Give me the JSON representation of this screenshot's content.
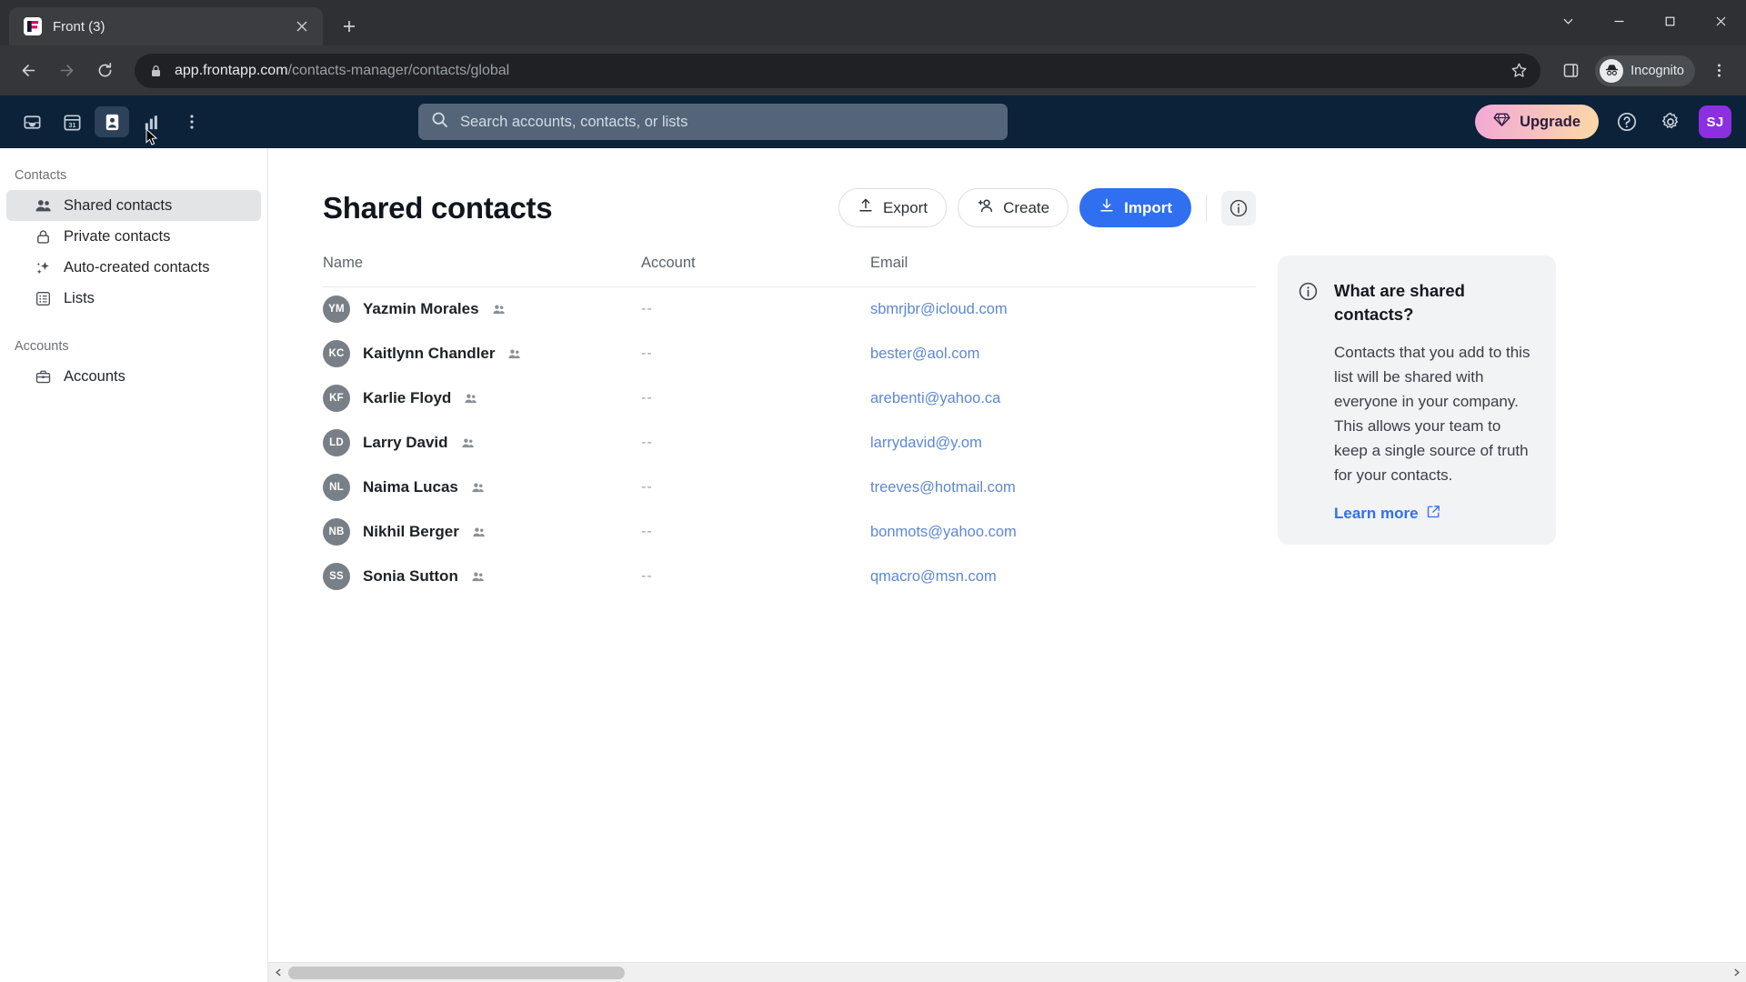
{
  "browser": {
    "tab": {
      "title": "Front (3)",
      "favicon_icon": "front-logo-icon",
      "close_icon": "close-icon"
    },
    "new_tab_icon": "plus-icon",
    "window_controls": {
      "chevron_icon": "chevron-down-icon",
      "minimize_icon": "minimize-icon",
      "maximize_icon": "maximize-icon",
      "close_icon": "close-icon"
    },
    "nav": {
      "back_icon": "back-arrow-icon",
      "forward_icon": "forward-arrow-icon",
      "reload_icon": "reload-icon"
    },
    "omnibox": {
      "lock_icon": "lock-icon",
      "url_host": "app.frontapp.com",
      "url_path": "/contacts-manager/contacts/global",
      "bookmark_icon": "star-icon"
    },
    "side_panel_icon": "side-panel-icon",
    "incognito": {
      "label": "Incognito",
      "icon": "incognito-icon"
    },
    "menu_icon": "kebab-menu-icon"
  },
  "app_header": {
    "nav_icons": [
      {
        "name": "inbox-icon",
        "label": "Inbox",
        "active": false
      },
      {
        "name": "calendar-icon",
        "label": "31",
        "active": false
      },
      {
        "name": "contacts-icon",
        "label": "Contacts",
        "active": true
      },
      {
        "name": "analytics-icon",
        "label": "Analytics",
        "active": false
      },
      {
        "name": "more-icon",
        "label": "More",
        "active": false
      }
    ],
    "search": {
      "placeholder": "Search accounts, contacts, or lists",
      "icon": "search-icon"
    },
    "upgrade": {
      "label": "Upgrade",
      "icon": "diamond-icon"
    },
    "help_icon": "help-circle-icon",
    "settings_icon": "gear-icon",
    "avatar": {
      "initials": "SJ",
      "color": "#8b2fe0"
    }
  },
  "sidebar": {
    "sections": [
      {
        "title": "Contacts",
        "items": [
          {
            "label": "Shared contacts",
            "icon": "people-icon",
            "active": true
          },
          {
            "label": "Private contacts",
            "icon": "lock-icon",
            "active": false
          },
          {
            "label": "Auto-created contacts",
            "icon": "sparkle-icon",
            "active": false
          },
          {
            "label": "Lists",
            "icon": "list-icon",
            "active": false
          }
        ]
      },
      {
        "title": "Accounts",
        "items": [
          {
            "label": "Accounts",
            "icon": "briefcase-icon",
            "active": false
          }
        ]
      }
    ]
  },
  "main": {
    "title": "Shared contacts",
    "actions": {
      "export": {
        "label": "Export",
        "icon": "upload-icon"
      },
      "create": {
        "label": "Create",
        "icon": "person-add-icon"
      },
      "import": {
        "label": "Import",
        "icon": "download-icon",
        "color": "#2f6ff0"
      },
      "info": {
        "icon": "info-circle-icon"
      }
    },
    "table": {
      "columns": [
        "Name",
        "Account",
        "Email"
      ],
      "rows": [
        {
          "initials": "YM",
          "name": "Yazmin Morales",
          "shared_icon": "people-icon",
          "account": "--",
          "email": "sbmrjbr@icloud.com"
        },
        {
          "initials": "KC",
          "name": "Kaitlynn Chandler",
          "shared_icon": "people-icon",
          "account": "--",
          "email": "bester@aol.com"
        },
        {
          "initials": "KF",
          "name": "Karlie Floyd",
          "shared_icon": "people-icon",
          "account": "--",
          "email": "arebenti@yahoo.ca"
        },
        {
          "initials": "LD",
          "name": "Larry David",
          "shared_icon": "people-icon",
          "account": "--",
          "email": "larrydavid@y.om"
        },
        {
          "initials": "NL",
          "name": "Naima Lucas",
          "shared_icon": "people-icon",
          "account": "--",
          "email": "treeves@hotmail.com"
        },
        {
          "initials": "NB",
          "name": "Nikhil Berger",
          "shared_icon": "people-icon",
          "account": "--",
          "email": "bonmots@yahoo.com"
        },
        {
          "initials": "SS",
          "name": "Sonia Sutton",
          "shared_icon": "people-icon",
          "account": "--",
          "email": "qmacro@msn.com"
        }
      ]
    },
    "info_card": {
      "icon": "info-circle-icon",
      "title": "What are shared contacts?",
      "body": "Contacts that you add to this list will be shared with everyone in your company. This allows your team to keep a single source of truth for your contacts.",
      "link": {
        "label": "Learn more",
        "icon": "external-link-icon"
      }
    }
  },
  "scrollbar": {
    "left_icon": "scroll-left-icon",
    "right_icon": "scroll-right-icon"
  }
}
